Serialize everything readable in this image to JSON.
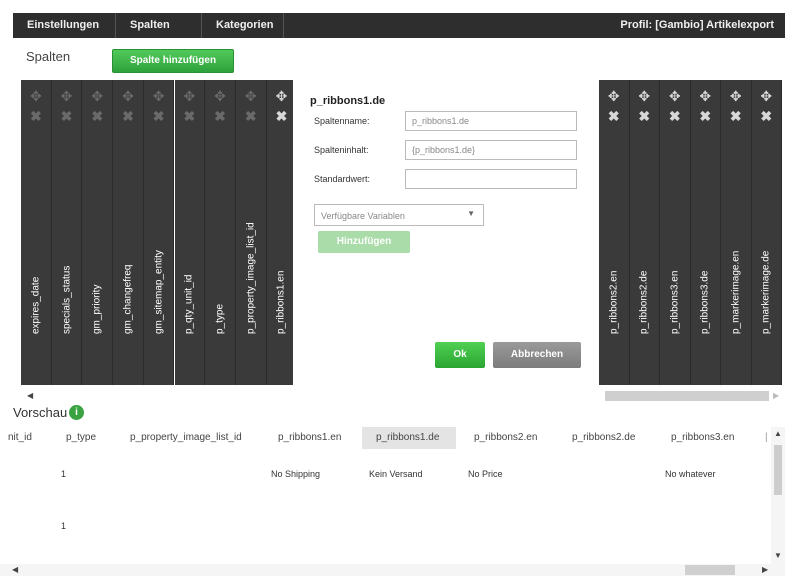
{
  "topbar": {
    "tabs": [
      "Einstellungen",
      "Spalten",
      "Kategorien"
    ],
    "profile": "Profil: [Gambio] Artikelexport"
  },
  "section": {
    "title": "Spalten",
    "add_button": "Spalte hinzufügen"
  },
  "left_columns": [
    "expires_date",
    "specials_status",
    "gm_priority",
    "gm_changefreq",
    "gm_sitemap_entity",
    "p_qty_unit_id",
    "p_type",
    "p_property_image_list_id",
    "p_ribbons1.en"
  ],
  "right_columns": [
    "p_ribbons2.en",
    "p_ribbons2.de",
    "p_ribbons3.en",
    "p_ribbons3.de",
    "p_markerimage.en",
    "p_markerimage.de"
  ],
  "icons": {
    "move": "move-icon",
    "delete": "close-icon"
  },
  "dialog": {
    "title": "p_ribbons1.de",
    "name_label": "Spaltenname:",
    "name_value": "p_ribbons1.de",
    "content_label": "Spalteninhalt:",
    "content_value": "{p_ribbons1.de}",
    "default_label": "Standardwert:",
    "default_value": "",
    "variables_placeholder": "Verfügbare Variablen",
    "add_button": "Hinzufügen",
    "ok_button": "Ok",
    "cancel_button": "Abbrechen"
  },
  "preview": {
    "title": "Vorschau",
    "info_icon": "i",
    "headers": [
      "nit_id",
      "p_type",
      "p_property_image_list_id",
      "p_ribbons1.en",
      "p_ribbons1.de",
      "p_ribbons2.en",
      "p_ribbons2.de",
      "p_ribbons3.en"
    ],
    "rows": [
      [
        "",
        "1",
        "",
        "No Shipping",
        "Kein Versand",
        "No Price",
        "",
        "No whatever"
      ],
      [
        "",
        "1",
        "",
        "",
        "",
        "",
        "",
        ""
      ]
    ]
  }
}
